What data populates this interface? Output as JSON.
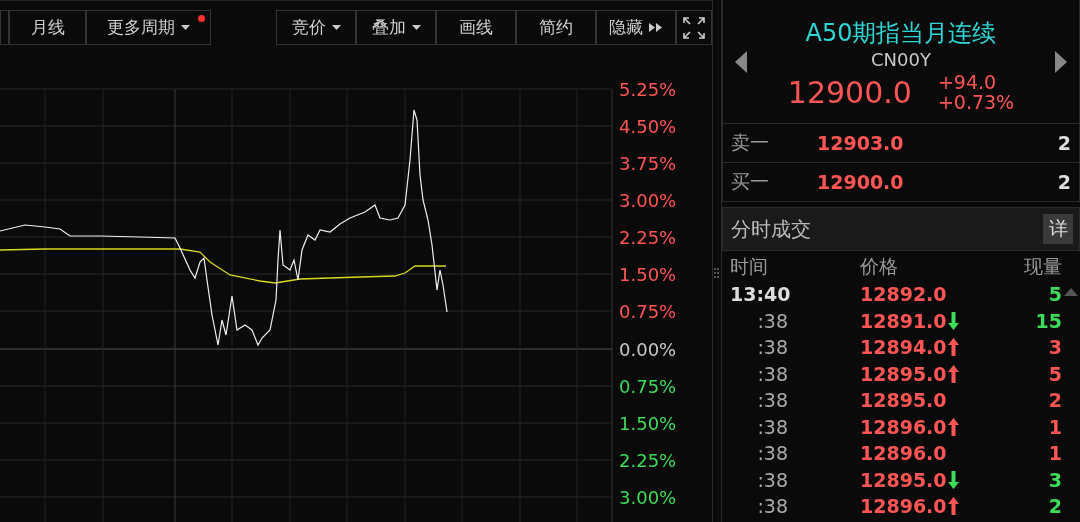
{
  "toolbar": {
    "left": [
      {
        "label": "月线",
        "dot": false,
        "kind": "plain"
      },
      {
        "label": "更多周期",
        "dot": true,
        "kind": "dropdown"
      }
    ],
    "right": [
      {
        "label": "竞价",
        "kind": "dropdown"
      },
      {
        "label": "叠加",
        "kind": "dropdown"
      },
      {
        "label": "画线",
        "kind": "plain"
      },
      {
        "label": "简约",
        "kind": "plain"
      },
      {
        "label": "隐藏",
        "kind": "expand"
      }
    ]
  },
  "chart": {
    "axis_labels": [
      {
        "text": "5.25%",
        "kind": "up"
      },
      {
        "text": "4.50%",
        "kind": "up"
      },
      {
        "text": "3.75%",
        "kind": "up"
      },
      {
        "text": "3.00%",
        "kind": "up"
      },
      {
        "text": "2.25%",
        "kind": "up"
      },
      {
        "text": "1.50%",
        "kind": "up"
      },
      {
        "text": "0.75%",
        "kind": "up"
      },
      {
        "text": "0.00%",
        "kind": "flat"
      },
      {
        "text": "0.75%",
        "kind": "down"
      },
      {
        "text": "1.50%",
        "kind": "down"
      },
      {
        "text": "2.25%",
        "kind": "down"
      },
      {
        "text": "3.00%",
        "kind": "down"
      }
    ]
  },
  "quote": {
    "title": "A50期指当月连续",
    "code": "CN00Y",
    "price": "12900.0",
    "change": "+94.0",
    "change_pct": "+0.73%"
  },
  "order_book": [
    {
      "label": "卖一",
      "price": "12903.0",
      "volume": "2"
    },
    {
      "label": "买一",
      "price": "12900.0",
      "volume": "2"
    }
  ],
  "ticks_panel": {
    "title": "分时成交",
    "detail_button": "详",
    "columns": [
      "时间",
      "价格",
      "现量"
    ],
    "rows": [
      {
        "time": "13:40",
        "price": "12892.0",
        "kind": "flat",
        "volume": "5",
        "color": "#3ddc5a"
      },
      {
        "time": ":38",
        "price": "12891.0",
        "kind": "down",
        "volume": "15",
        "color": "#3ddc5a"
      },
      {
        "time": ":38",
        "price": "12894.0",
        "kind": "up",
        "volume": "3",
        "color": "#ff5555"
      },
      {
        "time": ":38",
        "price": "12895.0",
        "kind": "up",
        "volume": "5",
        "color": "#ff5555"
      },
      {
        "time": ":38",
        "price": "12895.0",
        "kind": "flat",
        "volume": "2",
        "color": "#ff5555"
      },
      {
        "time": ":38",
        "price": "12896.0",
        "kind": "up",
        "volume": "1",
        "color": "#ff5555"
      },
      {
        "time": ":38",
        "price": "12896.0",
        "kind": "flat",
        "volume": "1",
        "color": "#ff5555"
      },
      {
        "time": ":38",
        "price": "12895.0",
        "kind": "down",
        "volume": "3",
        "color": "#3ddc5a"
      },
      {
        "time": ":38",
        "price": "12896.0",
        "kind": "up",
        "volume": "2",
        "color": "#3ddc5a"
      }
    ]
  }
}
